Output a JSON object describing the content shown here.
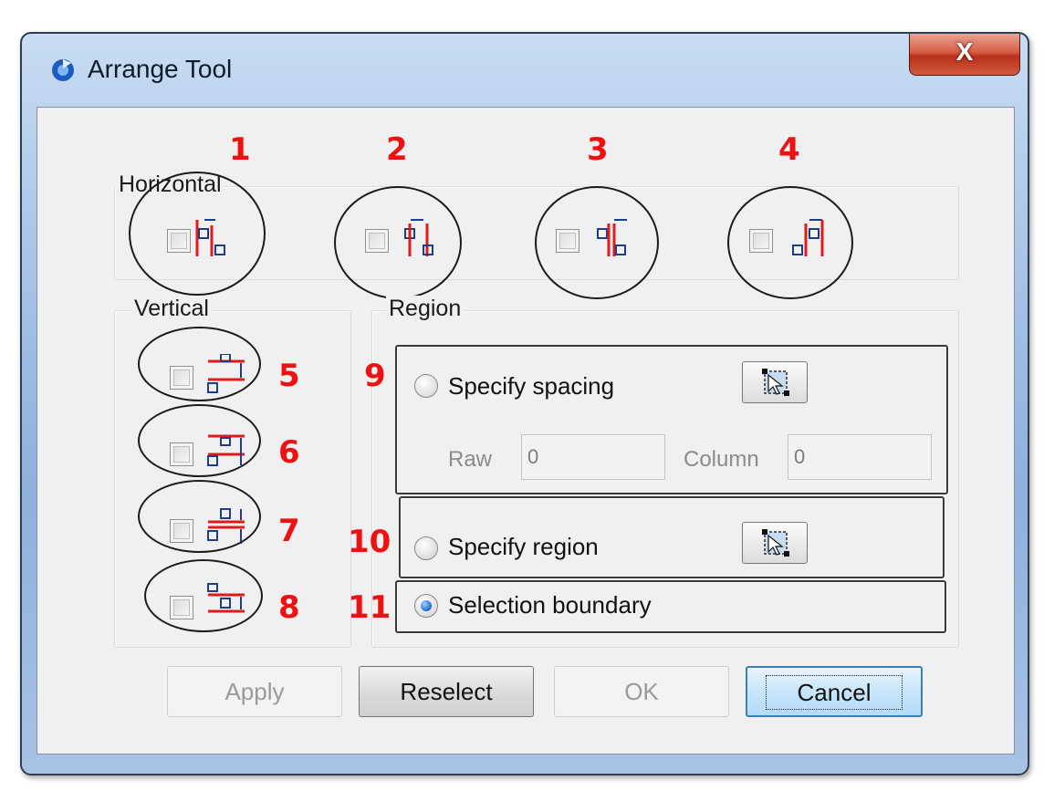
{
  "window": {
    "title": "Arrange Tool",
    "close_label": "X"
  },
  "horizontal": {
    "legend": "Horizontal",
    "markers": [
      "1",
      "2",
      "3",
      "4"
    ]
  },
  "vertical": {
    "legend": "Vertical",
    "markers": [
      "5",
      "6",
      "7",
      "8"
    ]
  },
  "region": {
    "legend": "Region",
    "specify_spacing": {
      "marker": "9",
      "label": "Specify spacing",
      "selected": false
    },
    "spacing_fields": {
      "raw_label": "Raw",
      "raw_value": "0",
      "column_label": "Column",
      "column_value": "0"
    },
    "specify_region": {
      "marker": "10",
      "label": "Specify region",
      "selected": false
    },
    "selection_boundary": {
      "marker": "11",
      "label": "Selection boundary",
      "selected": true
    }
  },
  "buttons": {
    "apply": "Apply",
    "reselect": "Reselect",
    "ok": "OK",
    "cancel": "Cancel"
  },
  "colors": {
    "marker_red": "#ee1111",
    "align_line_red": "#e01b1b",
    "icon_blue": "#1d3f8a"
  },
  "icons": {
    "app": "arrange-app-icon",
    "pick": "pick-region-cursor-icon"
  }
}
